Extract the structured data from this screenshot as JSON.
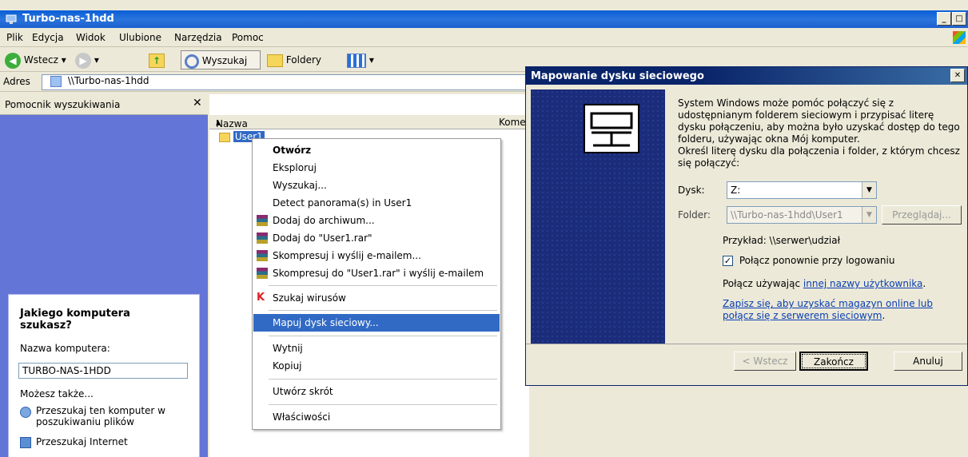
{
  "window": {
    "title": "Turbo-nas-1hdd"
  },
  "menubar": [
    "Plik",
    "Edycja",
    "Widok",
    "Ulubione",
    "Narzędzia",
    "Pomoc"
  ],
  "toolbar": {
    "back": "Wstecz",
    "search": "Wyszukaj",
    "folders": "Foldery"
  },
  "address": {
    "label": "Adres",
    "value": "\\\\Turbo-nas-1hdd"
  },
  "search_pane": {
    "title": "Pomocnik wyszukiwania",
    "question": "Jakiego komputera szukasz?",
    "computer_label": "Nazwa komputera:",
    "computer_value": "TURBO-NAS-1HDD",
    "also": "Możesz także...",
    "option1": "Przeszukaj ten komputer w poszukiwaniu plików",
    "option2": "Przeszukaj Internet"
  },
  "list": {
    "col_name": "Nazwa",
    "col_comment": "Kome",
    "item": "User1"
  },
  "context_menu": {
    "items": [
      "Otwórz",
      "Eksploruj",
      "Wyszukaj...",
      "Detect panorama(s) in User1",
      "Dodaj do archiwum...",
      "Dodaj do \"User1.rar\"",
      "Skompresuj i wyślij e-mailem...",
      "Skompresuj do \"User1.rar\" i wyślij e-mailem",
      "Szukaj wirusów",
      "Mapuj dysk sieciowy...",
      "Wytnij",
      "Kopiuj",
      "Utwórz skrót",
      "Właściwości"
    ],
    "selected_index": 9
  },
  "dialog": {
    "title": "Mapowanie dysku sieciowego",
    "intro": "System Windows może pomóc połączyć się z udostępnianym folderem sieciowym i przypisać literę dysku połączeniu, aby można było uzyskać dostęp do tego folderu, używając okna Mój komputer.",
    "instruction": "Określ literę dysku dla połączenia i folder, z którym chcesz się połączyć:",
    "drive_label": "Dysk:",
    "drive_value": "Z:",
    "folder_label": "Folder:",
    "folder_value": "\\\\Turbo-nas-1hdd\\User1",
    "browse": "Przeglądaj...",
    "example": "Przykład: \\\\serwer\\udział",
    "reconnect": "Połącz ponownie przy logowaniu",
    "reconnect_checked": true,
    "connect_using_prefix": "Połącz używając ",
    "connect_using_link": "innej nazwy użytkownika",
    "connect_using_suffix": ".",
    "signup_link": "Zapisz się, aby uzyskać magazyn online lub połącz się z serwerem sieciowym",
    "signup_suffix": ".",
    "back": "< Wstecz",
    "finish": "Zakończ",
    "cancel": "Anuluj"
  },
  "colors": {
    "xp_blue": "#0a5ed6",
    "selection": "#316ac5",
    "task_pane": "#6375d6"
  }
}
